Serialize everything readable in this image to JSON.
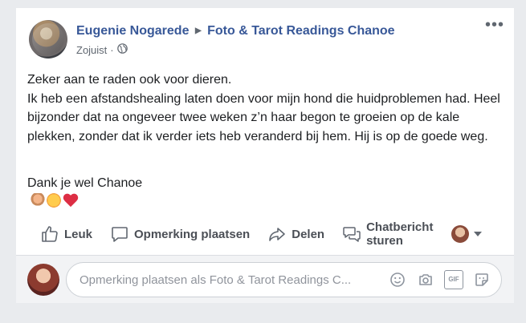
{
  "post": {
    "author": "Eugenie Nogarede",
    "page": "Foto & Tarot Readings Chanoe",
    "timestamp": "Zojuist",
    "privacy_icon": "globe-icon",
    "more_icon": "ellipsis-icon",
    "text_paragraph_1": "Zeker aan te raden ook voor dieren.\nIk heb een afstandshealing laten doen voor mijn hond die huidproblemen had. Heel bijzonder dat na ongeveer twee weken z’n haar begon te groeien op de kale plekken, zonder dat ik verder iets heb veranderd bij hem. Hij is op de goede weg.",
    "text_paragraph_2": "Dank je wel Chanoe",
    "emojis": [
      "folded-hands",
      "smiling-face",
      "red-heart"
    ]
  },
  "actions": {
    "like_label": "Leuk",
    "comment_label": "Opmerking plaatsen",
    "share_label": "Delen",
    "message_label": "Chatbericht sturen"
  },
  "comment_box": {
    "placeholder": "Opmerking plaatsen als Foto & Tarot Readings C...",
    "icons": [
      "emoji-icon",
      "camera-icon",
      "gif-icon",
      "sticker-icon"
    ],
    "gif_text": "GIF"
  },
  "colors": {
    "link": "#385898",
    "background": "#e9ebee",
    "card": "#ffffff",
    "heart": "#dd2e44"
  }
}
